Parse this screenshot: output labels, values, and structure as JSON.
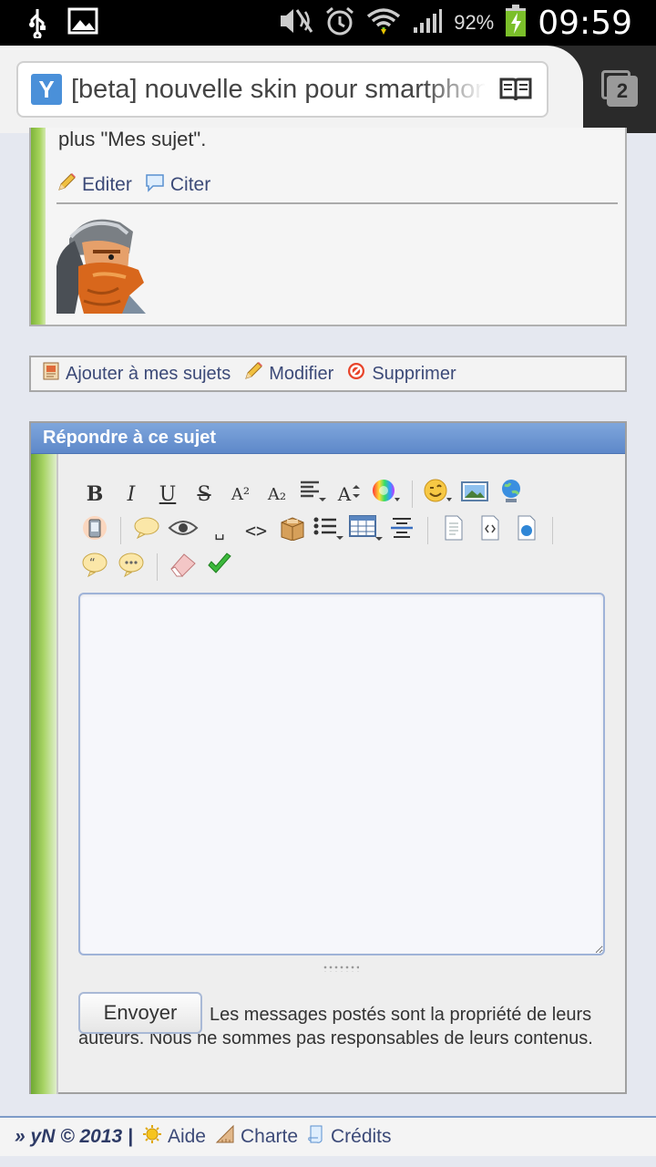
{
  "status_bar": {
    "battery_percent": "92%",
    "time": "09:59",
    "icons": [
      "usb-icon",
      "image-icon",
      "mute-icon",
      "alarm-icon",
      "wifi-icon",
      "signal-icon",
      "battery-charging-icon"
    ]
  },
  "browser": {
    "url_title": "[beta] nouvelle skin pour smartphone",
    "tab_count": "2",
    "favicon_letter": "Y"
  },
  "post": {
    "text_fragment": "plus \"Mes sujet\".",
    "actions": [
      {
        "label": "Editer",
        "icon": "pencil-icon"
      },
      {
        "label": "Citer",
        "icon": "quote-bubble-icon"
      }
    ]
  },
  "topic_tools": [
    {
      "label": "Ajouter à mes sujets",
      "icon": "bookmark-icon"
    },
    {
      "label": "Modifier",
      "icon": "pencil-icon"
    },
    {
      "label": "Supprimer",
      "icon": "forbidden-icon"
    }
  ],
  "reply": {
    "header": "Répondre à ce sujet",
    "textarea_value": "",
    "send_label": "Envoyer",
    "disclaimer": "Les messages postés sont la propriété de leurs auteurs. Nous ne sommes pas responsables de leurs contenus.",
    "toolbar": {
      "bold": "B",
      "italic": "I",
      "underline": "U",
      "strike": "S",
      "superscript": "A²",
      "subscript": "A₂",
      "fontsize": "A",
      "code_brackets": "<>",
      "space": "␣"
    }
  },
  "footer": {
    "copyright": "» yN © 2013 |",
    "links": [
      {
        "label": "Aide",
        "icon": "sun-help-icon"
      },
      {
        "label": "Charte",
        "icon": "ruler-icon"
      },
      {
        "label": "Crédits",
        "icon": "scroll-icon"
      }
    ]
  },
  "colors": {
    "accent_blue": "#6a93d2",
    "green_bar": "#8cc449",
    "link": "#3c4a78"
  }
}
